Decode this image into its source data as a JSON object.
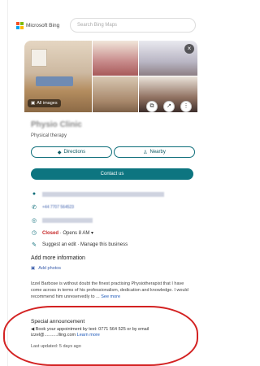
{
  "header": {
    "brand": "Microsoft Bing",
    "search_placeholder": "Search Bing Maps"
  },
  "gallery": {
    "all_images_label": "All images",
    "close_glyph": "×"
  },
  "business": {
    "name": "Physio Clinic",
    "category": "Physical therapy",
    "directions_label": "Directions",
    "nearby_label": "Nearby",
    "contact_label": "Contact us"
  },
  "details": {
    "address": "",
    "phone": "+44 7707 564523",
    "website": "",
    "closed_label": "Closed",
    "hours_text": "· Opens 8 AM ▾",
    "suggest_edit": "Suggest an edit · Manage this business"
  },
  "more": {
    "add_info_label": "Add more information",
    "add_photos_label": "Add photos"
  },
  "review": {
    "text": "Izzel Barbose is without doubt the finest practising Physiotherapist that I have come across in terms of his professionalism, dedication and knowledge. I would recommend him unreservedly to ...",
    "more_label": "See more"
  },
  "announcement": {
    "title": "Special announcement",
    "body": "Book your appointment by text: 0771 564 525 or by email izzel@...........lling.com",
    "learn_more": "Learn more",
    "updated": "Last updated: 5 days ago"
  }
}
